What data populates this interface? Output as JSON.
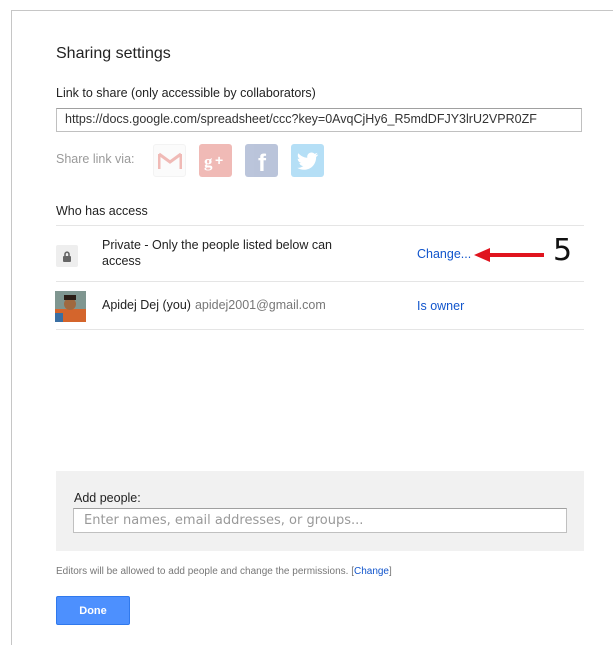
{
  "dialog": {
    "title": "Sharing settings",
    "link_label": "Link to share (only accessible by collaborators)",
    "link_value": "https://docs.google.com/spreadsheet/ccc?key=0AvqCjHy6_R5mdDFJY3lrU2VPR0ZF",
    "share_via_label": "Share link via:",
    "share_icons": [
      "gmail-icon",
      "google-plus-icon",
      "facebook-icon",
      "twitter-icon"
    ],
    "who_has_access_label": "Who has access",
    "access_rows": [
      {
        "icon": "lock-icon",
        "text": "Private - Only the people listed below can access",
        "action": "Change..."
      },
      {
        "icon": "avatar",
        "name": "Apidej Dej (you)",
        "email": "apidej2001@gmail.com",
        "role": "Is owner"
      }
    ],
    "annotation": {
      "step_number": "5",
      "arrow_color": "#e0141e"
    },
    "add_people": {
      "label": "Add people:",
      "placeholder": "Enter names, email addresses, or groups..."
    },
    "footnote": {
      "text": "Editors will be allowed to add people and change the permissions.",
      "bracket_open": "[",
      "link": "Change",
      "bracket_close": "]"
    },
    "done_label": "Done"
  },
  "colors": {
    "link_blue": "#1155cc",
    "button_blue": "#4d90fe",
    "panel_gray": "#f1f1f1"
  }
}
